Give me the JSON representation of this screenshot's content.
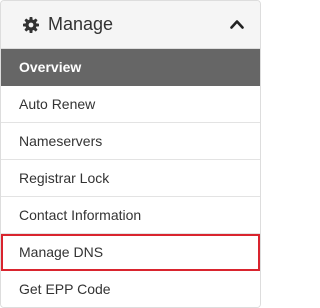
{
  "panel": {
    "title": "Manage",
    "icon": "gear-icon",
    "collapse_icon": "chevron-up-icon"
  },
  "menu": {
    "items": [
      {
        "label": "Overview",
        "active": true
      },
      {
        "label": "Auto Renew"
      },
      {
        "label": "Nameservers"
      },
      {
        "label": "Registrar Lock"
      },
      {
        "label": "Contact Information"
      },
      {
        "label": "Manage DNS",
        "highlighted": true
      },
      {
        "label": "Get EPP Code"
      }
    ]
  },
  "colors": {
    "active_bg": "#666666",
    "highlight_border": "#d9242e",
    "heading_bg": "#f5f5f5"
  }
}
